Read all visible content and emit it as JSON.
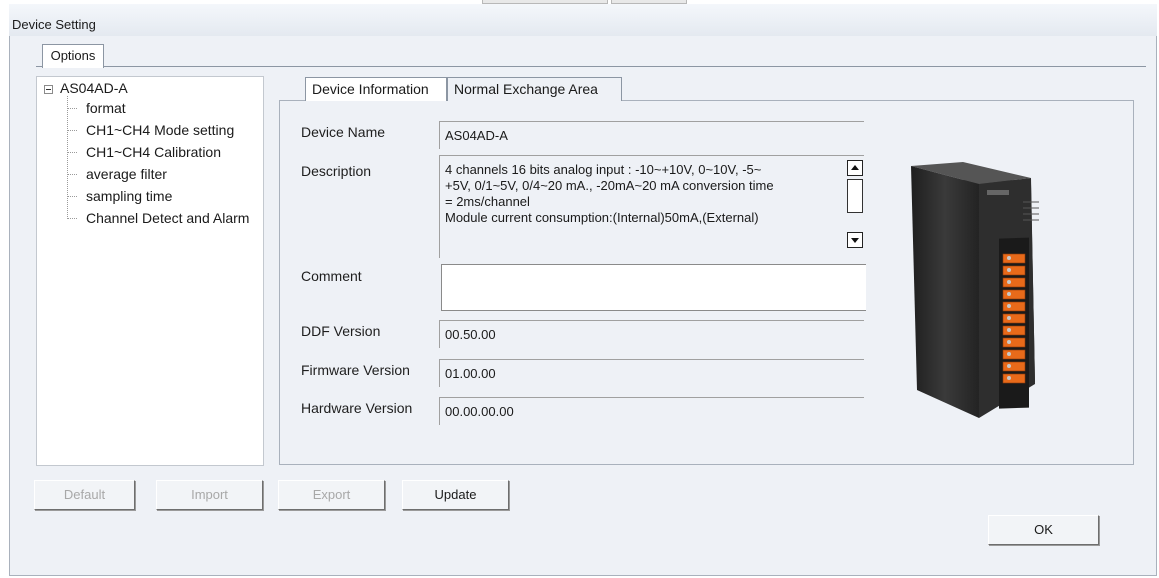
{
  "window": {
    "title": "Device Setting"
  },
  "options_tab": {
    "label": "Options"
  },
  "tree": {
    "root": "AS04AD-A",
    "items": [
      "format",
      "CH1~CH4 Mode setting",
      "CH1~CH4 Calibration",
      "average filter",
      "sampling time",
      "Channel Detect and Alarm"
    ]
  },
  "tabs": {
    "device_information": "Device Information",
    "normal_exchange_area": "Normal Exchange Area"
  },
  "fields": {
    "device_name": {
      "label": "Device Name",
      "value": "AS04AD-A"
    },
    "description": {
      "label": "Description",
      "lines": [
        "4 channels 16 bits analog input : -10~+10V, 0~10V, -5~",
        "+5V, 0/1~5V, 0/4~20 mA., -20mA~20 mA conversion time",
        "= 2ms/channel",
        "Module current consumption:(Internal)50mA,(External)"
      ]
    },
    "comment": {
      "label": "Comment",
      "value": ""
    },
    "ddf_version": {
      "label": "DDF Version",
      "value": "00.50.00"
    },
    "firmware_version": {
      "label": "Firmware Version",
      "value": "01.00.00"
    },
    "hardware_version": {
      "label": "Hardware Version",
      "value": "00.00.00.00"
    }
  },
  "buttons": {
    "default": "Default",
    "import": "Import",
    "export": "Export",
    "update": "Update",
    "ok": "OK"
  },
  "icons": {
    "tree_collapse": "minus-box-icon",
    "scroll_up": "scroll-up-arrow-icon",
    "scroll_down": "scroll-down-arrow-icon",
    "device": "device-module-image"
  },
  "colors": {
    "window_bg": "#eef1f6",
    "module_body": "#2b2b2b",
    "terminal_orange": "#e86a1a"
  }
}
